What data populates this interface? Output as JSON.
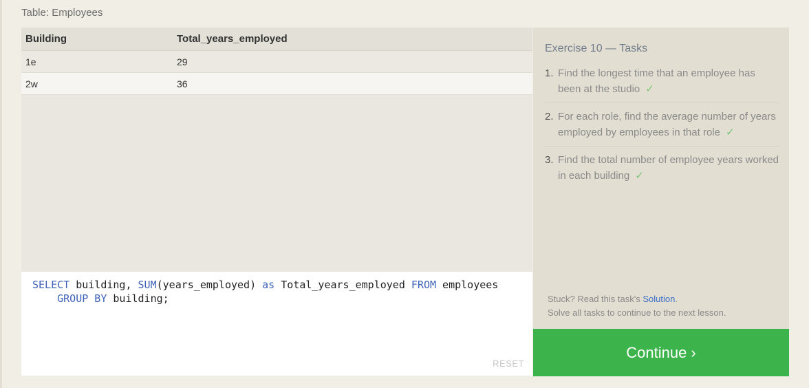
{
  "table_caption": "Table: Employees",
  "results": {
    "columns": [
      "Building",
      "Total_years_employed"
    ],
    "rows": [
      [
        "1e",
        "29"
      ],
      [
        "2w",
        "36"
      ]
    ]
  },
  "editor": {
    "line1": {
      "kw_select": "SELECT",
      "t1": " building, ",
      "kw_sum": "SUM",
      "t2": "(years_employed) ",
      "kw_as": "as",
      "t3": " Total_years_employed ",
      "kw_from": "FROM",
      "t4": " employees"
    },
    "line2": {
      "indent": "    ",
      "kw_group": "GROUP BY",
      "t1": " building;"
    },
    "reset_label": "RESET"
  },
  "tasks": {
    "title": "Exercise 10 — Tasks",
    "items": [
      {
        "num": "1.",
        "text": "Find the longest time that an employee has been at the studio",
        "check": "✓"
      },
      {
        "num": "2.",
        "text": "For each role, find the average number of years employed by employees in that role",
        "check": "✓"
      },
      {
        "num": "3.",
        "text": "Find the total number of employee years worked in each building",
        "check": "✓"
      }
    ],
    "stuck_prefix": "Stuck? Read this task's ",
    "solution_link": "Solution",
    "stuck_suffix": ".",
    "solve_all": "Solve all tasks to continue to the next lesson."
  },
  "continue_label": "Continue ›",
  "colors": {
    "continue_button": "#3db44b",
    "keyword": "#3e62b8",
    "checkmark": "#7ac47a",
    "link": "#3b6ec4"
  }
}
